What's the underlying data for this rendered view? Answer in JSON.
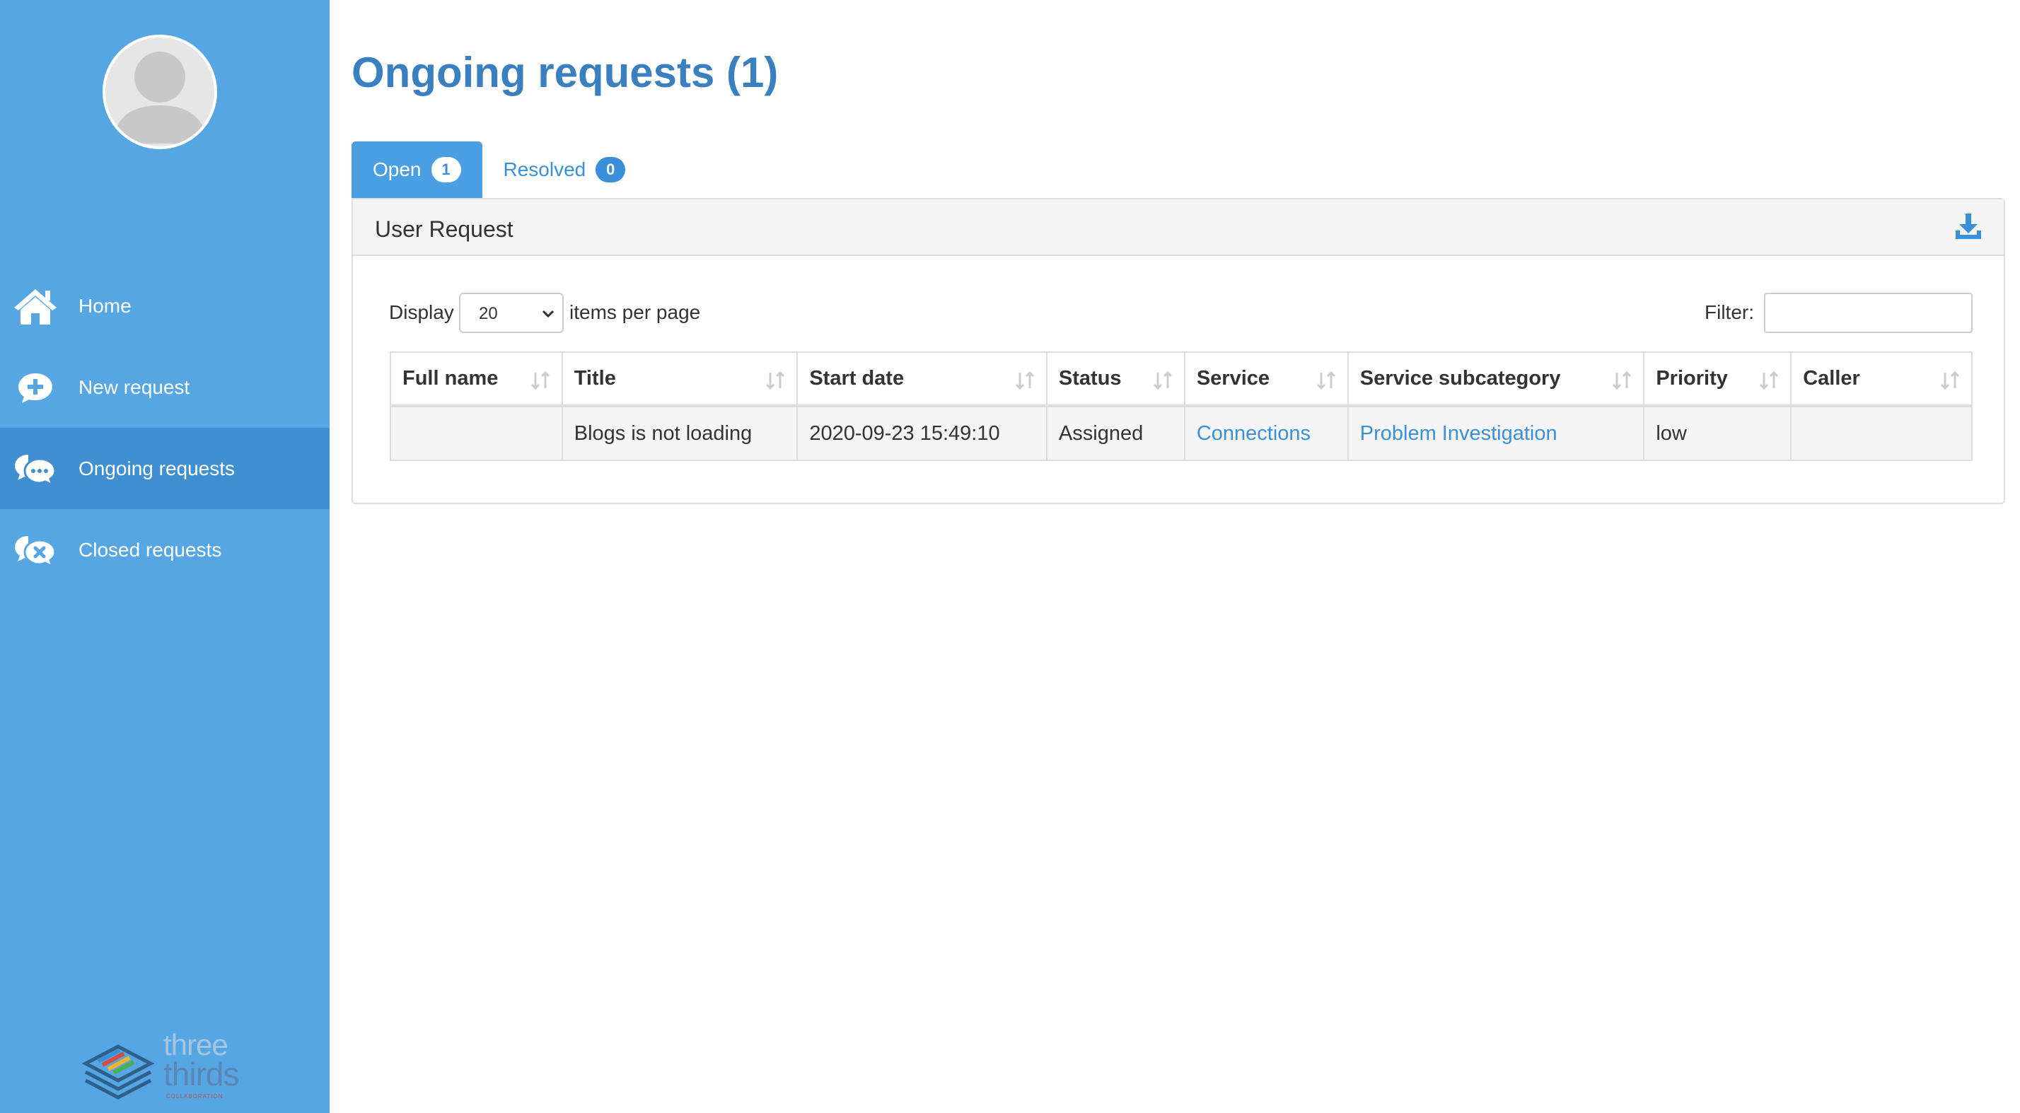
{
  "sidebar": {
    "items": [
      {
        "label": "Home",
        "icon": "home-icon"
      },
      {
        "label": "New request",
        "icon": "plus-circle-icon"
      },
      {
        "label": "Ongoing requests",
        "icon": "comments-icon",
        "active": true
      },
      {
        "label": "Closed requests",
        "icon": "comments-close-icon"
      }
    ],
    "logo": {
      "line1": "three",
      "line2": "thirds",
      "line3": "COLLABORATION"
    }
  },
  "main": {
    "title": "Ongoing requests (1)",
    "tabs": [
      {
        "label": "Open",
        "count": "1",
        "active": true
      },
      {
        "label": "Resolved",
        "count": "0",
        "active": false
      }
    ],
    "panel": {
      "title": "User Request",
      "display_label": "Display",
      "per_page_value": "20",
      "per_page_suffix": "items per page",
      "filter_label": "Filter:",
      "filter_value": ""
    },
    "table": {
      "columns": [
        "Full name",
        "Title",
        "Start date",
        "Status",
        "Service",
        "Service subcategory",
        "Priority",
        "Caller"
      ],
      "rows": [
        {
          "full_name": "",
          "title": "Blogs is not loading",
          "start_date": "2020-09-23 15:49:10",
          "status": "Assigned",
          "service": "Connections",
          "subcategory": "Problem Investigation",
          "priority": "low",
          "caller": ""
        }
      ]
    }
  },
  "colors": {
    "sidebar_bg": "#56a6e4",
    "sidebar_active": "#3f8fd1",
    "accent": "#3a90d8",
    "title": "#3a7fbf"
  }
}
